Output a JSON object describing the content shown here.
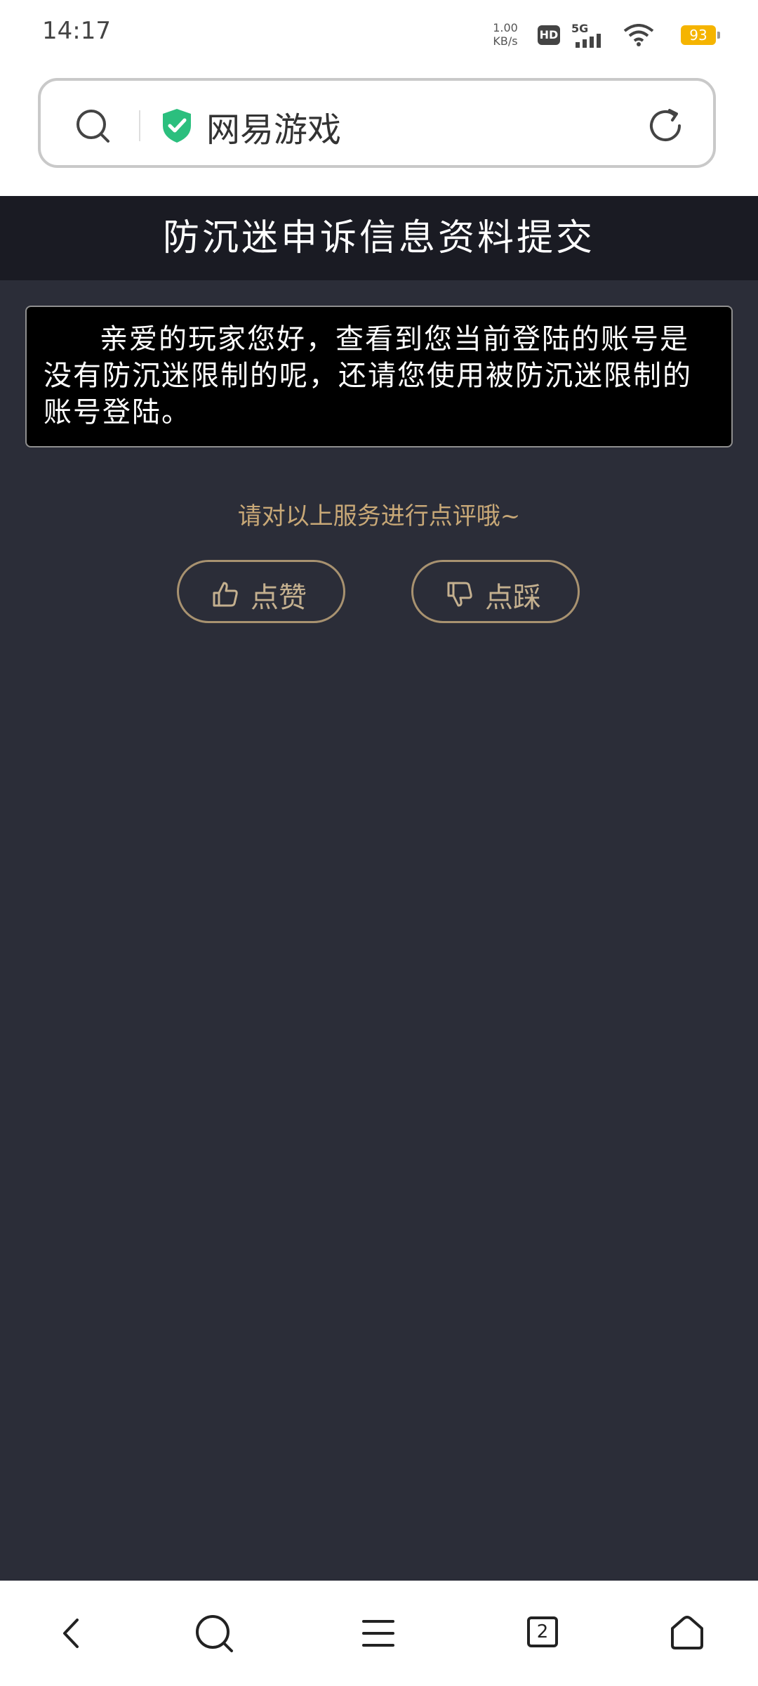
{
  "status_bar": {
    "time": "14:17",
    "net_speed_value": "1.00",
    "net_speed_unit": "KB/s",
    "hd_label": "HD",
    "network_label": "5G",
    "battery_level": "93",
    "battery_color": "#f5b400"
  },
  "address_bar": {
    "site_title": "网易游戏",
    "secure_icon": "shield-check-icon",
    "secure_color": "#2bbf7e"
  },
  "page": {
    "title": "防沉迷申诉信息资料提交",
    "notice": "亲爱的玩家您好，查看到您当前登陆的账号是没有防沉迷限制的呢，还请您使用被防沉迷限制的账号登陆。",
    "rating_prompt": "请对以上服务进行点评哦~",
    "like_label": "点赞",
    "dislike_label": "点踩",
    "accent_color": "#c8a877",
    "background_color": "#2b2d38"
  },
  "bottom_nav": {
    "tab_count": "2",
    "items": [
      "back-icon",
      "search-icon",
      "menu-icon",
      "tabs-icon",
      "home-icon"
    ]
  }
}
